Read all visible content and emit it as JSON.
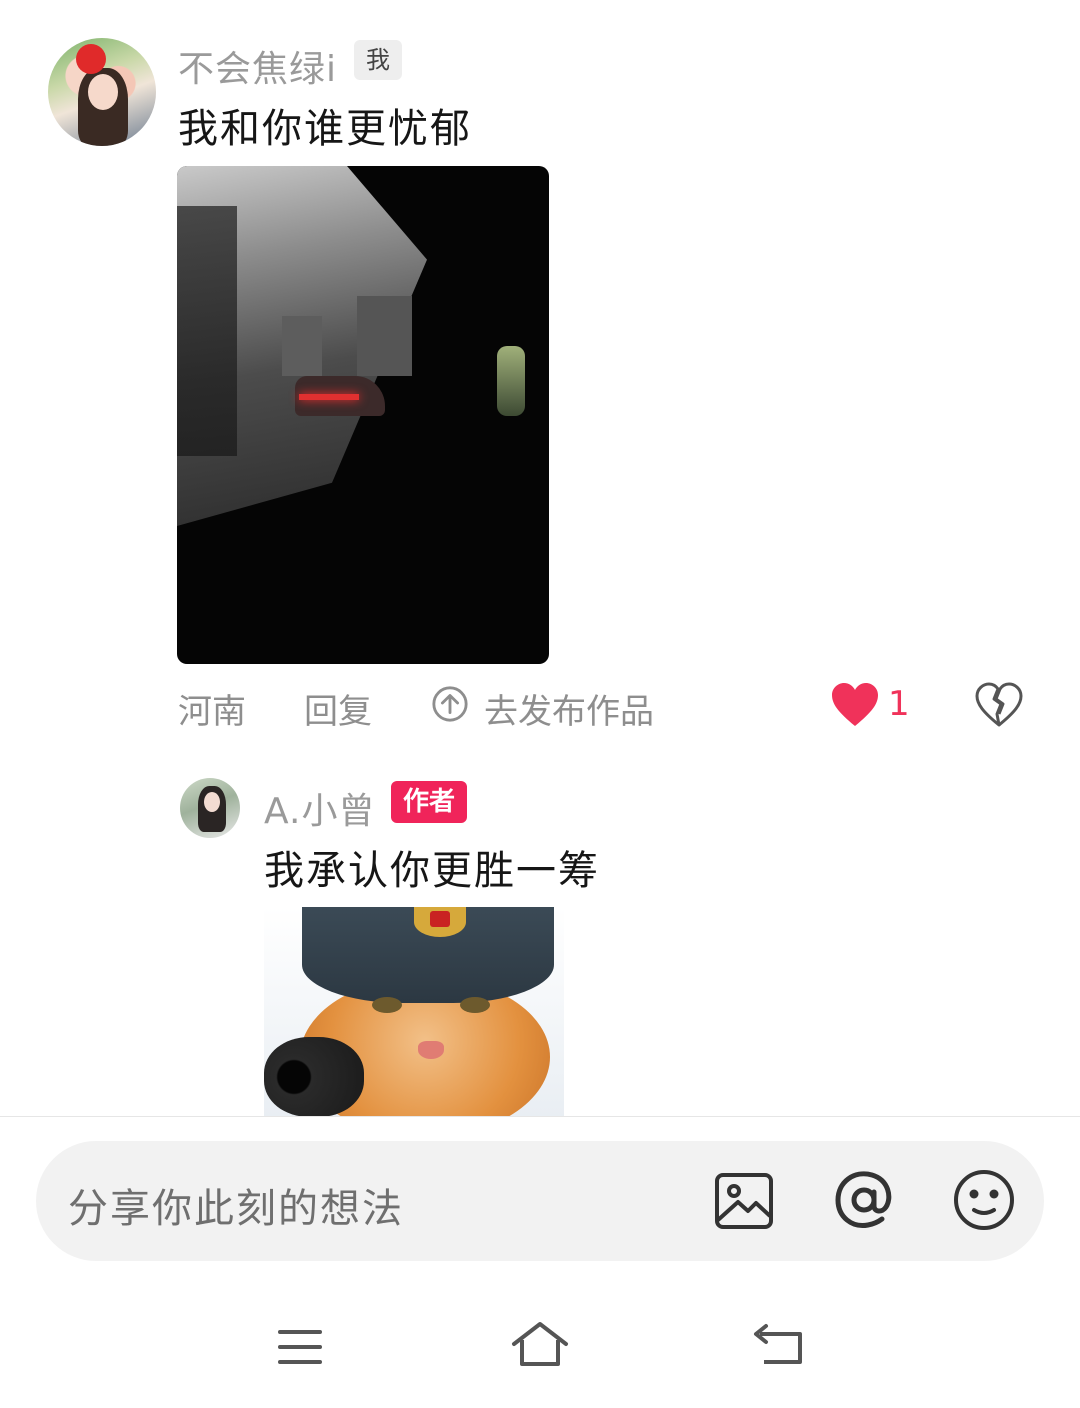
{
  "comment": {
    "username": "不会焦绿i",
    "badge": "我",
    "text": "我和你谁更忧郁",
    "image_alt": "rainy car window photo",
    "region": "河南",
    "reply_label": "回复",
    "publish_label": "去发布作品",
    "likes": "1"
  },
  "reply": {
    "username": "A.小曾",
    "badge": "作者",
    "text": "我承认你更胜一筹",
    "image_alt": "cat with hat and gun meme"
  },
  "input": {
    "placeholder": "分享你此刻的想法"
  },
  "icons": {
    "publish": "upload-circle-icon",
    "like": "heart-icon",
    "dislike": "broken-heart-icon",
    "image": "image-icon",
    "mention": "at-icon",
    "emoji": "emoji-icon",
    "menu": "menu-icon",
    "home": "home-icon",
    "back": "back-icon"
  },
  "colors": {
    "accent": "#f0325a",
    "author_badge": "#f0245a",
    "muted_text": "#8e8e8e"
  }
}
